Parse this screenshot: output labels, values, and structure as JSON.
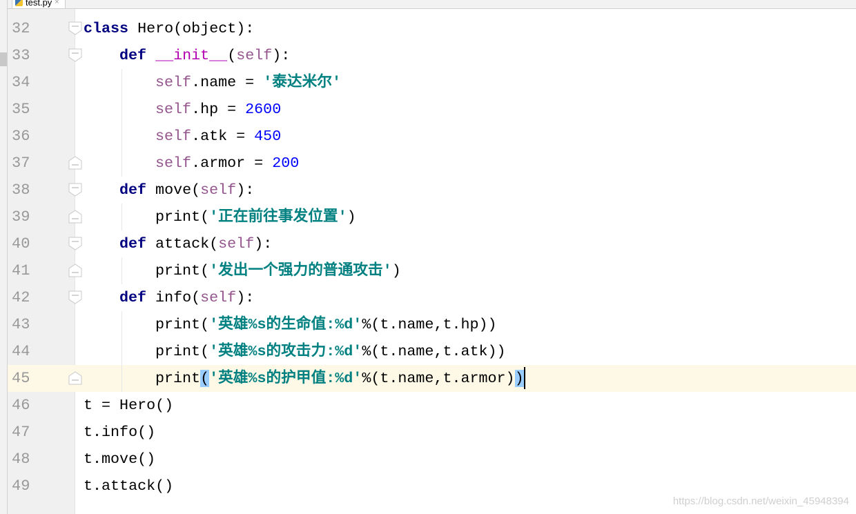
{
  "tab": {
    "filename": "test.py",
    "icon": "python-file-icon",
    "close": "×"
  },
  "current_line": 45,
  "lines": [
    {
      "n": "32",
      "fold": "open",
      "indent": 0,
      "tokens": [
        [
          "kw",
          "class"
        ],
        [
          "",
          " Hero(object):"
        ]
      ]
    },
    {
      "n": "33",
      "fold": "open",
      "indent": 1,
      "tokens": [
        [
          "kw",
          "def"
        ],
        [
          "",
          " "
        ],
        [
          "magic",
          "__init__"
        ],
        [
          "",
          "("
        ],
        [
          "self",
          "self"
        ],
        [
          "",
          "):"
        ]
      ]
    },
    {
      "n": "34",
      "fold": "",
      "indent": 2,
      "tokens": [
        [
          "self",
          "self"
        ],
        [
          "",
          ".name = "
        ],
        [
          "str",
          "'泰达米尔'"
        ]
      ]
    },
    {
      "n": "35",
      "fold": "",
      "indent": 2,
      "tokens": [
        [
          "self",
          "self"
        ],
        [
          "",
          ".hp = "
        ],
        [
          "num",
          "2600"
        ]
      ]
    },
    {
      "n": "36",
      "fold": "",
      "indent": 2,
      "tokens": [
        [
          "self",
          "self"
        ],
        [
          "",
          ".atk = "
        ],
        [
          "num",
          "450"
        ]
      ]
    },
    {
      "n": "37",
      "fold": "end",
      "indent": 2,
      "tokens": [
        [
          "self",
          "self"
        ],
        [
          "",
          ".armor = "
        ],
        [
          "num",
          "200"
        ]
      ]
    },
    {
      "n": "38",
      "fold": "open",
      "indent": 1,
      "tokens": [
        [
          "kw",
          "def"
        ],
        [
          "",
          " move("
        ],
        [
          "self",
          "self"
        ],
        [
          "",
          "):"
        ]
      ]
    },
    {
      "n": "39",
      "fold": "end",
      "indent": 2,
      "tokens": [
        [
          "",
          "print("
        ],
        [
          "str",
          "'正在前往事发位置'"
        ],
        [
          "",
          ")"
        ]
      ]
    },
    {
      "n": "40",
      "fold": "open",
      "indent": 1,
      "tokens": [
        [
          "kw",
          "def"
        ],
        [
          "",
          " attack("
        ],
        [
          "self",
          "self"
        ],
        [
          "",
          "):"
        ]
      ]
    },
    {
      "n": "41",
      "fold": "end",
      "indent": 2,
      "tokens": [
        [
          "",
          "print("
        ],
        [
          "str",
          "'发出一个强力的普通攻击'"
        ],
        [
          "",
          ")"
        ]
      ]
    },
    {
      "n": "42",
      "fold": "open",
      "indent": 1,
      "tokens": [
        [
          "kw",
          "def"
        ],
        [
          "",
          " info("
        ],
        [
          "self",
          "self"
        ],
        [
          "",
          "):"
        ]
      ]
    },
    {
      "n": "43",
      "fold": "",
      "indent": 2,
      "tokens": [
        [
          "",
          "print("
        ],
        [
          "str",
          "'英雄%s的生命值:%d'"
        ],
        [
          "",
          "%(t.name,t.hp))"
        ]
      ]
    },
    {
      "n": "44",
      "fold": "",
      "indent": 2,
      "tokens": [
        [
          "",
          "print("
        ],
        [
          "str",
          "'英雄%s的攻击力:%d'"
        ],
        [
          "",
          "%(t.name,t.atk))"
        ]
      ]
    },
    {
      "n": "45",
      "fold": "end",
      "indent": 2,
      "tokens": [
        [
          "",
          "print"
        ],
        [
          "brace",
          "("
        ],
        [
          "str",
          "'英雄%s的护甲值:%d'"
        ],
        [
          "",
          "%(t.name,t.armor)"
        ],
        [
          "brace",
          ")"
        ],
        [
          "caret",
          ""
        ]
      ]
    },
    {
      "n": "46",
      "fold": "",
      "indent": 0,
      "tokens": [
        [
          "",
          "t = Hero()"
        ]
      ]
    },
    {
      "n": "47",
      "fold": "",
      "indent": 0,
      "tokens": [
        [
          "",
          "t.info()"
        ]
      ]
    },
    {
      "n": "48",
      "fold": "",
      "indent": 0,
      "tokens": [
        [
          "",
          "t.move()"
        ]
      ]
    },
    {
      "n": "49",
      "fold": "",
      "indent": 0,
      "tokens": [
        [
          "",
          "t.attack()"
        ]
      ]
    }
  ],
  "watermark": "https://blog.csdn.net/weixin_45948394"
}
